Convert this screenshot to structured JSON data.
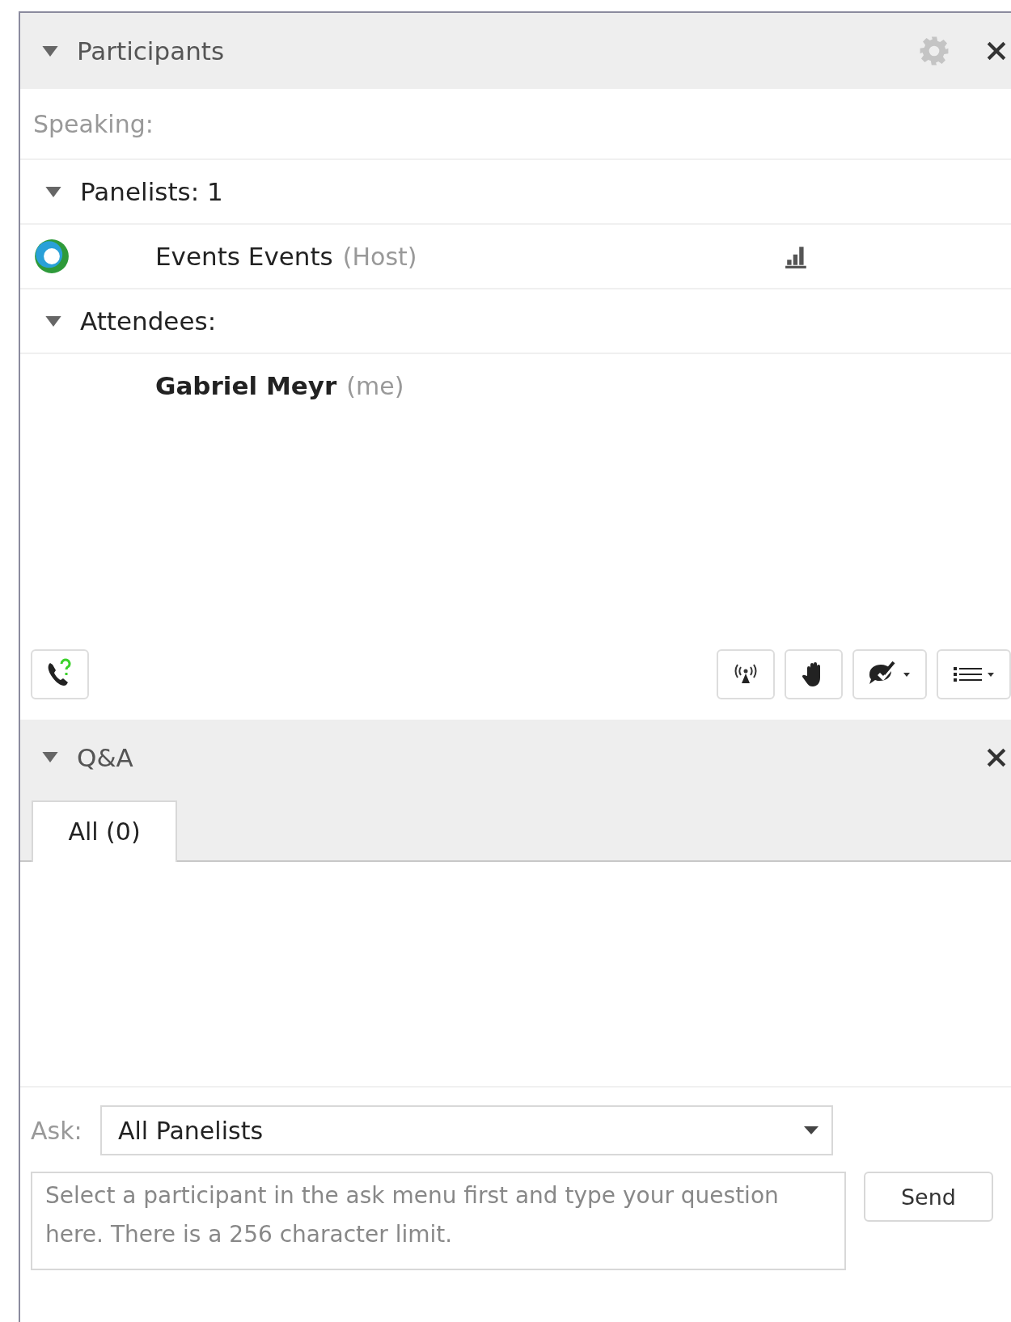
{
  "participants_panel": {
    "title": "Participants",
    "expanded": true,
    "speaking_label": "Speaking:",
    "groups": [
      {
        "label": "Panelists: 1",
        "expanded": true,
        "members": [
          {
            "name": "Events Events",
            "role": "(Host)",
            "kind": "host"
          }
        ]
      },
      {
        "label": "Attendees:",
        "expanded": true,
        "members": [
          {
            "name": "Gabriel Meyr",
            "role": "(me)",
            "kind": "self"
          }
        ]
      }
    ]
  },
  "qa_panel": {
    "title": "Q&A",
    "expanded": true,
    "tabs": [
      {
        "label": "All (0)",
        "selected": true
      }
    ],
    "ask_label": "Ask:",
    "ask_value": "All Panelists",
    "question": {
      "placeholder": "Select a participant in the ask menu first and type your question here. There is a 256 character limit."
    },
    "send_button": "Send"
  }
}
